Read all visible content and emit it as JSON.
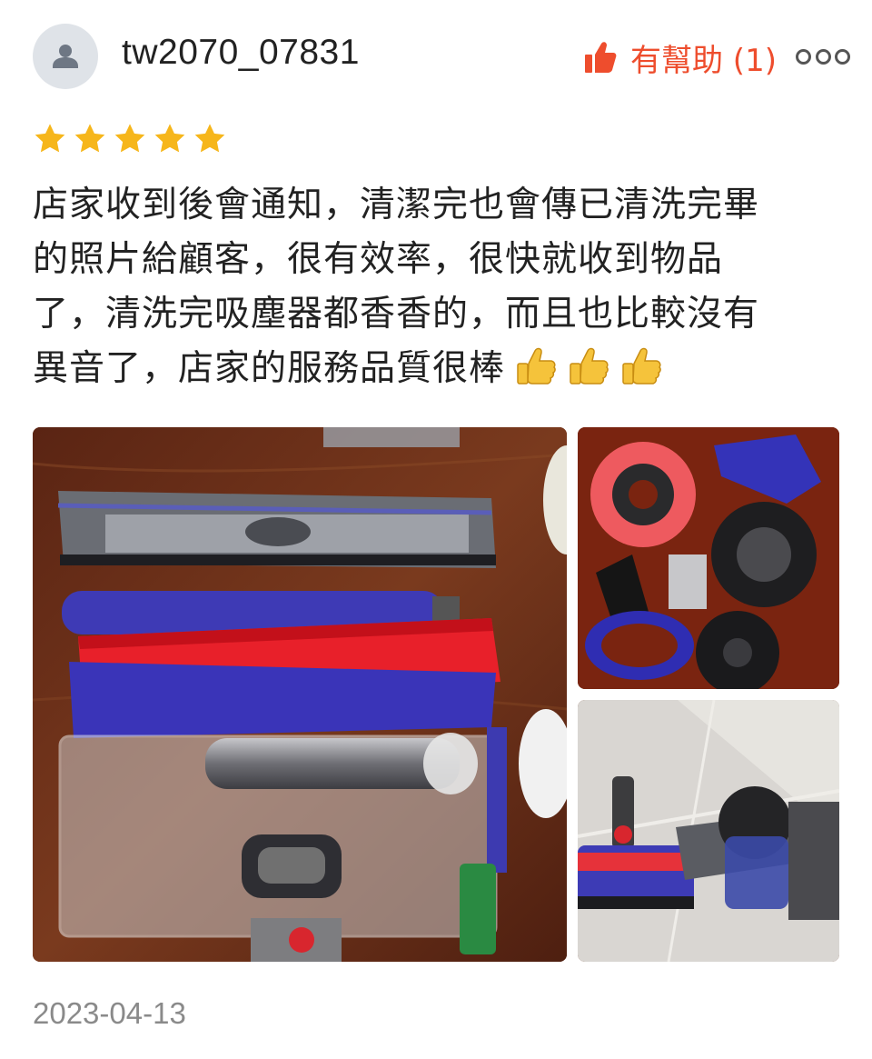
{
  "review": {
    "username": "tw2070_07831",
    "helpful_label": "有幫助 (1)",
    "rating": 5,
    "text_lines": [
      "店家收到後會通知，清潔完也會傳已清洗完畢",
      "的照片給顧客，很有效率，很快就收到物品",
      "了，清洗完吸塵器都香香的，而且也比較沒有",
      "異音了，店家的服務品質很棒"
    ],
    "emojis": [
      "thumbs-up-emoji",
      "thumbs-up-emoji",
      "thumbs-up-emoji"
    ],
    "date": "2023-04-13"
  },
  "photos": [
    {
      "name": "photo-brush-roller-parts"
    },
    {
      "name": "photo-vacuum-filter-parts"
    },
    {
      "name": "photo-assembled-vacuum"
    }
  ],
  "icons": {
    "avatar": "user-avatar-icon",
    "helpful": "thumbs-up-icon",
    "more": "more-options-icon",
    "star": "star-icon"
  },
  "colors": {
    "accent": "#ee4d2d",
    "star": "#f6b61b",
    "muted": "#8a8a8a",
    "avatar_bg": "#dfe3e8"
  }
}
